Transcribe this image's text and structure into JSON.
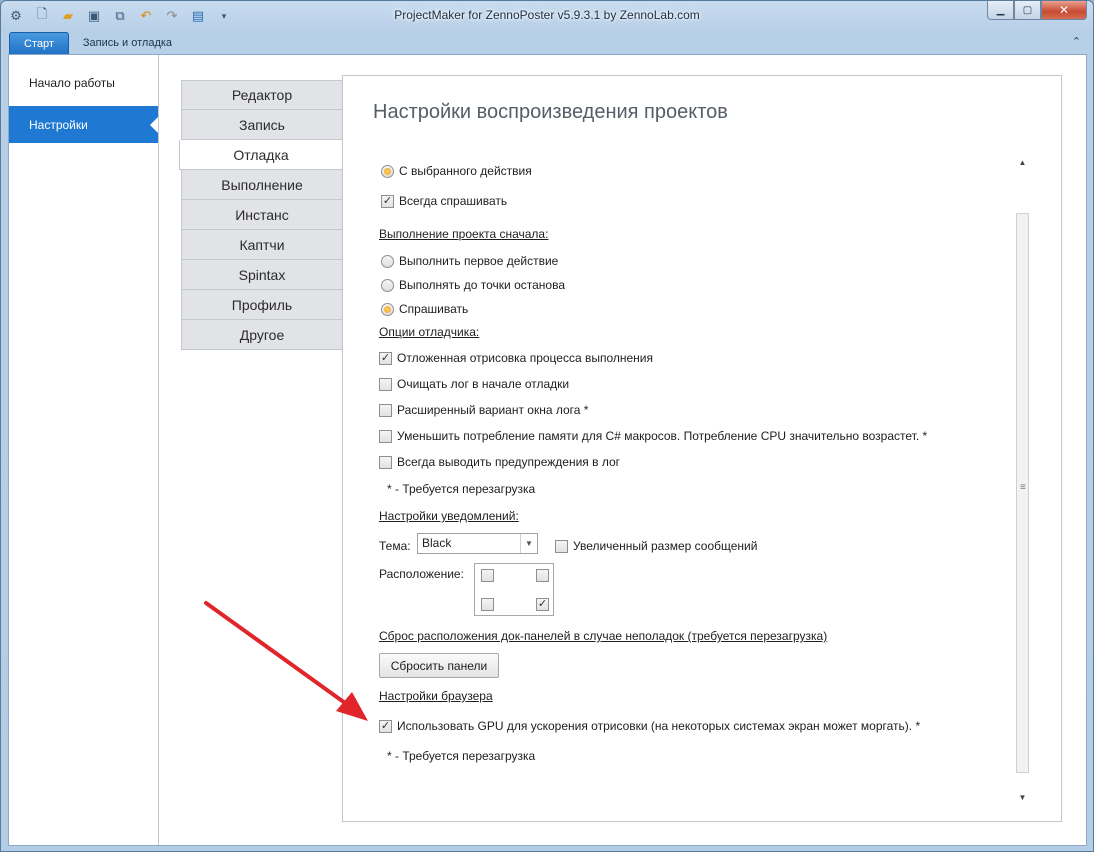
{
  "window": {
    "title": "ProjectMaker for ZennoPoster v5.9.3.1 by ZennoLab.com",
    "qat_icons": [
      "app-icon",
      "new-file-icon",
      "open-folder-icon",
      "save-icon",
      "save-all-icon",
      "undo-icon",
      "redo-icon",
      "window-icon",
      "customize-icon"
    ]
  },
  "ribbon": {
    "tabs": [
      {
        "label": "Старт",
        "active": true
      },
      {
        "label": "Запись и отладка",
        "active": false
      }
    ]
  },
  "left_nav": {
    "items": [
      {
        "label": "Начало работы",
        "active": false
      },
      {
        "label": "Настройки",
        "active": true
      }
    ]
  },
  "settings_tabs": [
    {
      "label": "Редактор",
      "active": false
    },
    {
      "label": "Запись",
      "active": false
    },
    {
      "label": "Отладка",
      "active": true
    },
    {
      "label": "Выполнение",
      "active": false
    },
    {
      "label": "Инстанс",
      "active": false
    },
    {
      "label": "Каптчи",
      "active": false
    },
    {
      "label": "Spintax",
      "active": false
    },
    {
      "label": "Профиль",
      "active": false
    },
    {
      "label": "Другое",
      "active": false
    }
  ],
  "panel": {
    "title": "Настройки воспроизведения проектов",
    "start_from_selected": {
      "label": "С выбранного действия",
      "selected": true
    },
    "always_ask": {
      "label": "Всегда спрашивать",
      "checked": true
    },
    "exec_section": {
      "title": "Выполнение проекта сначала:",
      "options": [
        {
          "label": "Выполнить первое действие",
          "selected": false
        },
        {
          "label": "Выполнять до точки останова",
          "selected": false
        },
        {
          "label": "Спрашивать",
          "selected": true
        }
      ]
    },
    "debugger_section": {
      "title": "Опции отладчика:",
      "options": [
        {
          "label": "Отложенная отрисовка процесса выполнения",
          "checked": true
        },
        {
          "label": "Очищать лог в начале отладки",
          "checked": false
        },
        {
          "label": "Расширенный вариант окна лога *",
          "checked": false
        },
        {
          "label": "Уменьшить потребление памяти для C# макросов. Потребление CPU значительно возрастет. *",
          "checked": false
        },
        {
          "label": "Всегда выводить предупреждения в лог",
          "checked": false
        }
      ],
      "note": "* - Требуется перезагрузка"
    },
    "notify_section": {
      "title": "Настройки уведомлений:",
      "theme_label": "Тема:",
      "theme_value": "Black",
      "large_msg": {
        "label": "Увеличенный размер сообщений",
        "checked": false
      },
      "position_label": "Расположение:",
      "positions": {
        "top_left": false,
        "top_right": false,
        "bottom_left": false,
        "bottom_right": true
      }
    },
    "reset_section": {
      "title": "Сброс расположения док-панелей в случае неполадок (требуется перезагрузка)",
      "button": "Сбросить панели"
    },
    "browser_section": {
      "title": "Настройки браузера",
      "gpu": {
        "label": "Использовать GPU для ускорения отрисовки (на некоторых системах экран может моргать). *",
        "checked": true
      },
      "note": "* - Требуется перезагрузка"
    }
  },
  "colors": {
    "accent": "#1f78d1",
    "annotation_arrow": "#e0262b"
  }
}
